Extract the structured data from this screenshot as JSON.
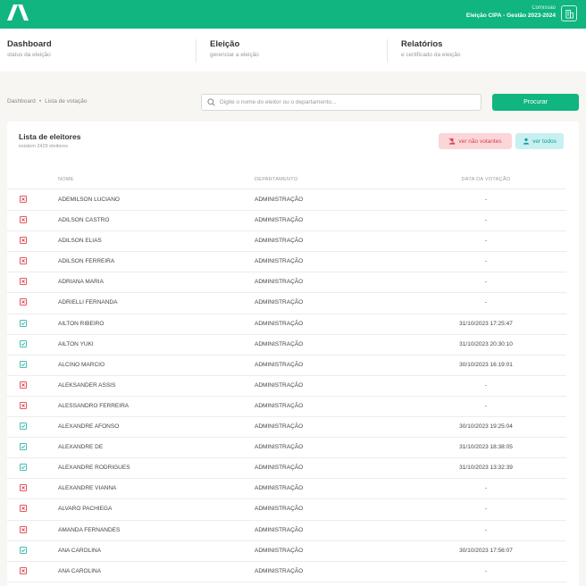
{
  "header": {
    "commission_label": "Comissão",
    "election_name": "Eleição CIPA - Gestão 2023-2024",
    "accent": "#10b57f"
  },
  "nav": {
    "items": [
      {
        "title": "Dashboard",
        "subtitle": "status da eleição"
      },
      {
        "title": "Eleição",
        "subtitle": "gerenciar a eleição"
      },
      {
        "title": "Relatórios",
        "subtitle": "e certificado da eleição"
      }
    ]
  },
  "breadcrumb": {
    "root": "Dashboard",
    "current": "Lista de votação"
  },
  "search": {
    "placeholder": "Digite o nome do eleitor ou o departamento...",
    "value": "",
    "button_label": "Procurar"
  },
  "list": {
    "title": "Lista de eleitores",
    "subtitle": "existem 2429 eleitores",
    "filter_nonvoters_label": "ver não votantes",
    "filter_all_label": "ver todos",
    "columns": {
      "name": "NOME",
      "department": "DEPARTAMENTO",
      "vote_date": "DATA DA VOTAÇÃO"
    },
    "rows": [
      {
        "voted": false,
        "name": "ADEMILSON LUCIANO",
        "department": "ADMINISTRAÇÃO",
        "date": "-"
      },
      {
        "voted": false,
        "name": "ADILSON CASTRO",
        "department": "ADMINISTRAÇÃO",
        "date": "-"
      },
      {
        "voted": false,
        "name": "ADILSON ELIAS",
        "department": "ADMINISTRAÇÃO",
        "date": "-"
      },
      {
        "voted": false,
        "name": "ADILSON FERREIRA",
        "department": "ADMINISTRAÇÃO",
        "date": "-"
      },
      {
        "voted": false,
        "name": "ADRIANA MARIA",
        "department": "ADMINISTRAÇÃO",
        "date": "-"
      },
      {
        "voted": false,
        "name": "ADRIELLI FERNANDA",
        "department": "ADMINISTRAÇÃO",
        "date": "-"
      },
      {
        "voted": true,
        "name": "AILTON RIBEIRO",
        "department": "ADMINISTRAÇÃO",
        "date": "31/10/2023 17:25:47"
      },
      {
        "voted": true,
        "name": "AILTON YUKI",
        "department": "ADMINISTRAÇÃO",
        "date": "31/10/2023 20:30:10"
      },
      {
        "voted": true,
        "name": "ALCINO MARCIO",
        "department": "ADMINISTRAÇÃO",
        "date": "30/10/2023 16:19:01"
      },
      {
        "voted": false,
        "name": "ALEKSANDER ASSIS",
        "department": "ADMINISTRAÇÃO",
        "date": "-"
      },
      {
        "voted": false,
        "name": "ALESSANDRO FERREIRA",
        "department": "ADMINISTRAÇÃO",
        "date": "-"
      },
      {
        "voted": true,
        "name": "ALEXANDRE AFONSO",
        "department": "ADMINISTRAÇÃO",
        "date": "30/10/2023 19:25:04"
      },
      {
        "voted": true,
        "name": "ALEXANDRE DE",
        "department": "ADMINISTRAÇÃO",
        "date": "31/10/2023 18:38:05"
      },
      {
        "voted": true,
        "name": "ALEXANDRE RODRIGUES",
        "department": "ADMINISTRAÇÃO",
        "date": "31/10/2023 13:32:39"
      },
      {
        "voted": false,
        "name": "ALEXANDRE VIANNA",
        "department": "ADMINISTRAÇÃO",
        "date": "-"
      },
      {
        "voted": false,
        "name": "ALVARO PACHIEGA",
        "department": "ADMINISTRAÇÃO",
        "date": "-"
      },
      {
        "voted": false,
        "name": "AMANDA FERNANDES",
        "department": "ADMINISTRAÇÃO",
        "date": "-"
      },
      {
        "voted": true,
        "name": "ANA CAROLINA",
        "department": "ADMINISTRAÇÃO",
        "date": "30/10/2023 17:56:07"
      },
      {
        "voted": false,
        "name": "ANA CAROLINA",
        "department": "ADMINISTRAÇÃO",
        "date": "-"
      }
    ]
  },
  "colors": {
    "voted": "#2bb6a8",
    "not_voted": "#e0404c"
  },
  "icons": {
    "voted": "check-square-icon",
    "not_voted": "x-square-icon"
  }
}
